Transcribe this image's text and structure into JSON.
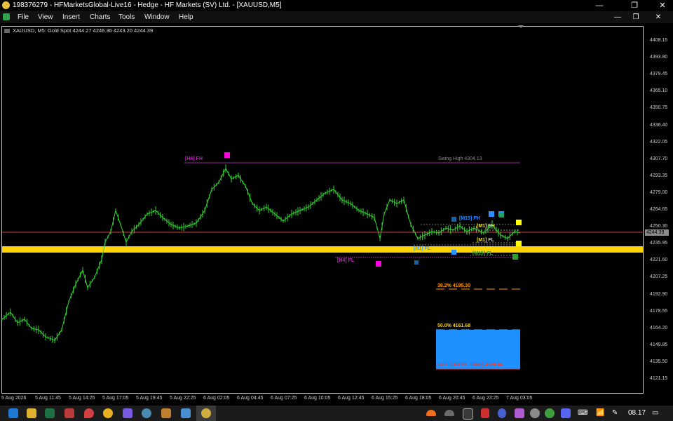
{
  "window": {
    "title": "198376279 - HFMarketsGlobal-Live16 - Hedge - HF Markets (SV) Ltd. - [XAUUSD,M5]",
    "min_glyph": "—",
    "max_glyph": "❐",
    "close_glyph": "✕"
  },
  "menu": [
    "File",
    "View",
    "Insert",
    "Charts",
    "Tools",
    "Window",
    "Help"
  ],
  "mdi": {
    "min_glyph": "—",
    "restore_glyph": "❐",
    "close_glyph": "✕"
  },
  "chart": {
    "caption": "XAUUSD, M5:  Gold Spot  4244.27 4246.36 4243.20 4244.39",
    "current_price": "4244.39",
    "price_ticks": [
      "4408.15",
      "4393.80",
      "4379.45",
      "4365.10",
      "4350.75",
      "4336.40",
      "4322.05",
      "4307.70",
      "4293.35",
      "4279.00",
      "4264.65",
      "4250.30",
      "4235.95",
      "4221.60",
      "4207.25",
      "4192.90",
      "4178.55",
      "4164.20",
      "4149.85",
      "4135.50",
      "4121.15"
    ],
    "time_ticks": [
      "5 Aug 2026",
      "5 Aug 11:45",
      "5 Aug 14:25",
      "5 Aug 17:05",
      "5 Aug 19:45",
      "5 Aug 22:25",
      "6 Aug 02:05",
      "6 Aug 04:45",
      "6 Aug 07:25",
      "6 Aug 10:05",
      "6 Aug 12:45",
      "6 Aug 15:25",
      "6 Aug 18:05",
      "6 Aug 20:45",
      "6 Aug 23:25",
      "7 Aug 03:05"
    ],
    "labels": {
      "h4_fh": "[H4] FH",
      "swing_high": "Swing High 4304.13",
      "m15_fh": "[M15] FH",
      "m1_fh": "[M1] FH",
      "m1_fl": "[M1] FL",
      "h1_fl": "[H1] FL",
      "m15_fl": "[M15] FL",
      "h4_fl": "[H4] FL",
      "fib_382": "38.2%  4195.30",
      "fib_500": "50.0%  4161.68",
      "entry_zone": "BUY [ENTRY ZONE]  4128.06"
    },
    "colors": {
      "candles": "#2fd42f",
      "yellow_zone": "#ffd400",
      "price_line": "#d04040",
      "h4": "#c020c0",
      "m15": "#2a8fff",
      "m1": "#f0e000",
      "fib": "#ff9900",
      "entry_box": "#1e90ff"
    }
  },
  "taskbar": {
    "icons": [
      "file-explorer",
      "excel",
      "folder-red",
      "maps",
      "chrome",
      "video-app",
      "browser-2",
      "archive",
      "notes",
      "metatrader"
    ],
    "tray_icons": [
      "cloud",
      "onedrive",
      "monitor",
      "battery",
      "chat",
      "discord",
      "wifi",
      "pen"
    ],
    "clock": "08.17"
  }
}
